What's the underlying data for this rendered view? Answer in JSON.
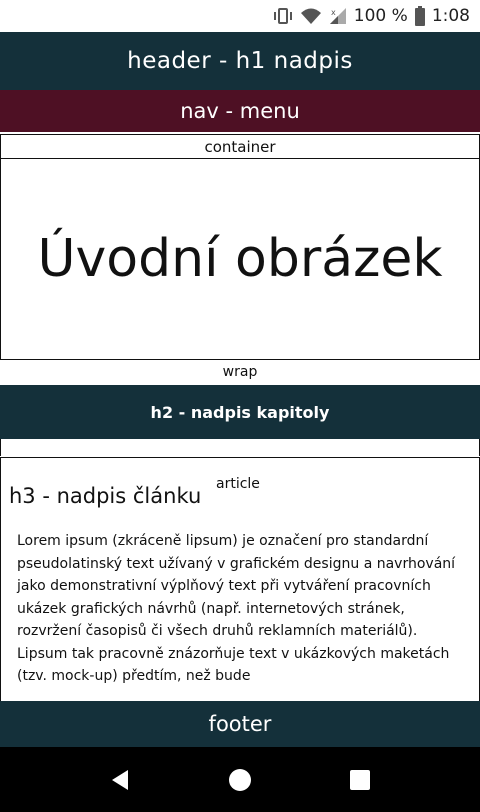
{
  "status_bar": {
    "battery": "100 %",
    "time": "1:08",
    "icons": [
      "vibrate-icon",
      "wifi-icon",
      "signal-icon",
      "battery-icon"
    ]
  },
  "header": {
    "title": "header - h1 nadpis"
  },
  "nav": {
    "label": "nav - menu"
  },
  "container": {
    "label": "container"
  },
  "intro": {
    "text": "Úvodní obrázek"
  },
  "wrap": {
    "label": "wrap"
  },
  "chapter": {
    "title": "h2 - nadpis kapitoly"
  },
  "article": {
    "title": "h3 - nadpis článku",
    "tag": "article",
    "body": "Lorem ipsum (zkráceně lipsum) je označení pro standardní pseudolatinský text užívaný v grafickém designu a navrhování jako demonstrativní výplňový text při vytváření pracovních ukázek grafických návrhů (např. internetových stránek, rozvržení časopisů či všech druhů reklamních materiálů). Lipsum tak pracovně znázorňuje text v ukázkových maketách (tzv. mock-up) předtím, než bude"
  },
  "footer": {
    "label": "footer"
  },
  "navbar": {
    "icons": [
      "back-icon",
      "home-icon",
      "recents-icon"
    ]
  },
  "colors": {
    "header_bg": "#14303a",
    "nav_bg": "#4e1024",
    "footer_bg": "#14303a"
  }
}
